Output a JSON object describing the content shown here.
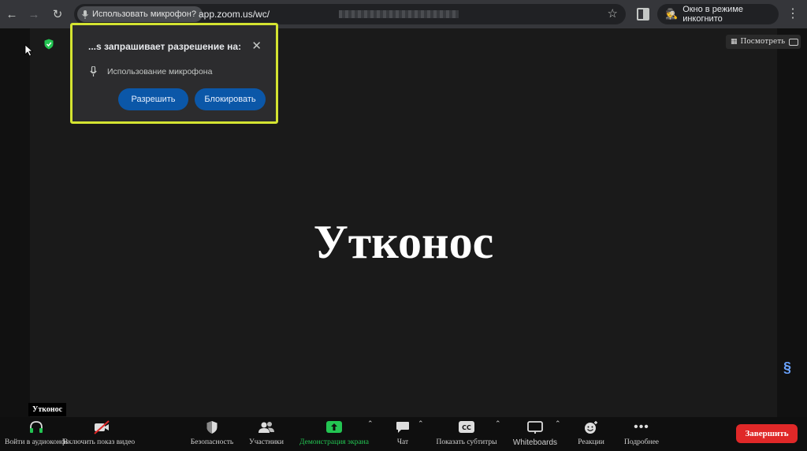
{
  "browser": {
    "permission_chip": "Использовать микрофон?",
    "url": "app.zoom.us/wc/",
    "incognito_label": "Окно в режиме инкогнито"
  },
  "popup": {
    "title": "...s запрашивает разрешение на:",
    "permission": "Использование микрофона",
    "allow_label": "Разрешить",
    "block_label": "Блокировать",
    "highlight_color": "#d4e431"
  },
  "meeting": {
    "view_label": "Посмотреть",
    "participant_name": "Утконос",
    "name_tag": "Утконос"
  },
  "toolbar": {
    "audio": "Войти в аудиоконференцию",
    "video": "Включить показ видео",
    "security": "Безопасность",
    "participants": "Участники",
    "share": "Демонстрация экрана",
    "chat": "Чат",
    "captions": "Показать субтитры",
    "whiteboards": "Whiteboards",
    "reactions": "Реакции",
    "more": "Подробнее",
    "end": "Завершить",
    "share_color": "#23c552",
    "end_color": "#e02828"
  }
}
